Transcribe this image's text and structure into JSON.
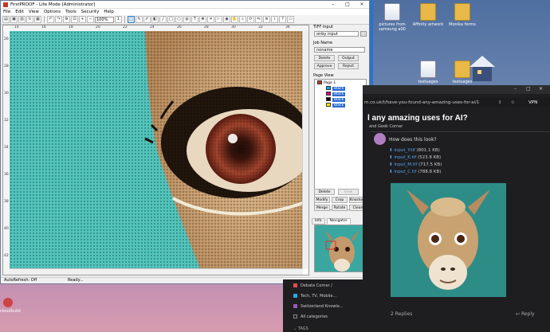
{
  "app": {
    "title": "FirstPROOF - Lite Mode [Administrator]",
    "window_controls": [
      "–",
      "□",
      "✕"
    ],
    "menu": [
      "File",
      "Edit",
      "View",
      "Options",
      "Tools",
      "Security",
      "Help"
    ],
    "zoom": "100%",
    "ruler_h_ticks": [
      "14",
      "16",
      "18",
      "20",
      "22",
      "24",
      "26",
      "28",
      "30",
      "32",
      "34"
    ],
    "ruler_v_ticks": [
      "26",
      "28",
      "30",
      "32",
      "34",
      "36",
      "38",
      "40",
      "42"
    ],
    "status": {
      "autorefresh": "AutoRefresh: Off",
      "state": "Ready..."
    }
  },
  "panel": {
    "tiff_label": "TIFF Input",
    "tiff_value": "onby input",
    "job_label": "Job Name",
    "job_value": "noname",
    "buttons_top": [
      "Delete",
      "Output",
      "Approve",
      "Reject"
    ],
    "page_view_label": "Page View",
    "tree": {
      "page": "Page 1",
      "separations": [
        {
          "name": "Black",
          "color": "#00aeef"
        },
        {
          "name": "Black",
          "color": "#e4007c"
        },
        {
          "name": "Black",
          "color": "#000000"
        },
        {
          "name": "Black",
          "color": "#ffee00"
        }
      ]
    },
    "buttons_bottom": [
      "Delete",
      "View",
      "Modify",
      "Crop",
      "Knockout",
      "Merge",
      "Rotate",
      "Clean"
    ],
    "tabs": [
      "Info",
      "Navigator"
    ]
  },
  "desktop": {
    "icons": [
      {
        "label": "pictures from samsung a00"
      },
      {
        "label": "Affinity artwork"
      },
      {
        "label": "Monika forms"
      },
      {
        "label": "textuages"
      },
      {
        "label": "textuages"
      },
      {
        "label": "cloudbuild"
      }
    ]
  },
  "browser": {
    "url": "m.co.uk/t/have-you-found-any-amazing-uses-for-ai/1",
    "vpn": "VPN",
    "topic_title": "l any amazing uses for AI?",
    "category": "and Geek Corner",
    "post_text": "How does this look?",
    "attachments": [
      {
        "name": "input_Y.tif",
        "size": "(801.1 KB)"
      },
      {
        "name": "input_K.tif",
        "size": "(523.8 KB)"
      },
      {
        "name": "input_M.tif",
        "size": "(717.5 KB)"
      },
      {
        "name": "input_C.tif",
        "size": "(788.8 KB)"
      }
    ],
    "sidebar_categories": [
      {
        "label": "Debate Corner /",
        "color": "#e24b4b"
      },
      {
        "label": "Tech, TV, Mobile...",
        "color": "#25aae1"
      },
      {
        "label": "Switzerland Knowle...",
        "color": "#9b59b6"
      },
      {
        "label": "All categories",
        "color": ""
      }
    ],
    "tags_label": "TAGS",
    "replies": "2 Replies",
    "reply_button": "Reply"
  },
  "colors": {
    "accent": "#2b73c8",
    "title_blue": "#2b6bd1"
  }
}
